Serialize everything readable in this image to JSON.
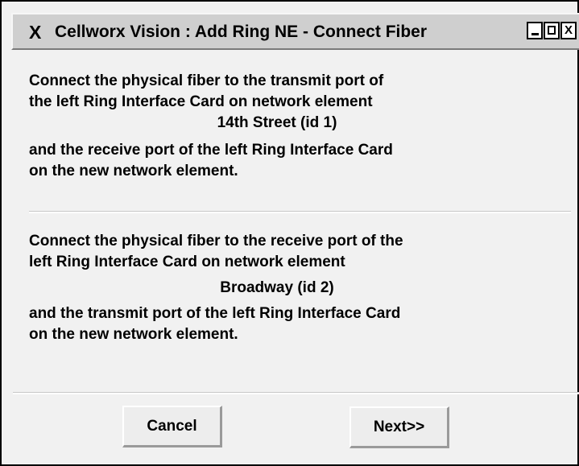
{
  "window": {
    "title_glyph": "X",
    "title": "Cellworx Vision : Add Ring NE - Connect Fiber",
    "controls": [
      "minimize",
      "maximize",
      "close"
    ],
    "close_glyph": "X"
  },
  "instructions": {
    "first": {
      "line1": "Connect the physical fiber to the transmit port of",
      "line2": "the left Ring Interface Card on network element",
      "element": "14th Street (id 1)",
      "line3": "and the receive port of the left Ring Interface Card",
      "line4": "on the new network element."
    },
    "second": {
      "line1": "Connect the physical fiber to the receive port of the",
      "line2": "left Ring Interface Card on network element",
      "element": "Broadway  (id 2)",
      "line3": "and the transmit port of the left Ring Interface Card",
      "line4": "on the new network element."
    }
  },
  "buttons": {
    "cancel": "Cancel",
    "next": "Next>>"
  }
}
